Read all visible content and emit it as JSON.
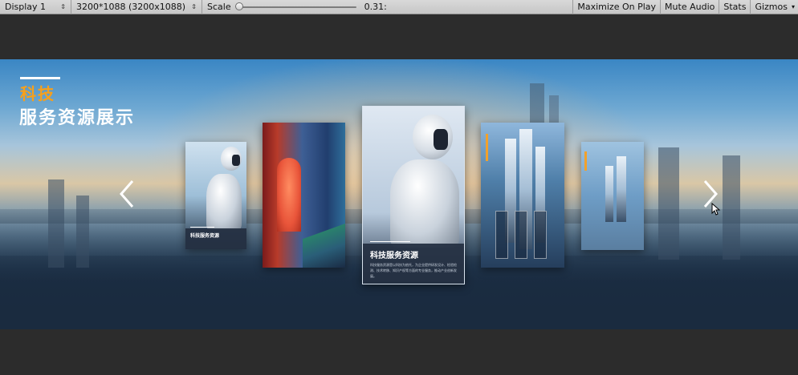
{
  "toolbar": {
    "display": "Display 1",
    "resolution": "3200*1088 (3200x1088)",
    "scale_label": "Scale",
    "scale_value": "0.31:",
    "scale_fraction": 0.0,
    "buttons": {
      "maximize": "Maximize On Play",
      "mute": "Mute Audio",
      "stats": "Stats",
      "gizmos": "Gizmos"
    },
    "dropdown_icon": "chevron-updown-icon"
  },
  "game": {
    "title_line1": "科技",
    "title_line2": "服务资源展示",
    "title_accent_color": "#f7a01b",
    "nav": {
      "left_icon": "chevron-left-icon",
      "right_icon": "chevron-right-icon"
    },
    "cards": [
      {
        "caption_title": "科技服务资源"
      },
      {},
      {
        "caption_title": "科技服务资源",
        "caption_text": "科技服务资源是以科技为依托，为企业提供研发设计、检验检测、技术转移、知识产权等方面的专业服务，推动产业创新发展。"
      },
      {},
      {}
    ]
  }
}
